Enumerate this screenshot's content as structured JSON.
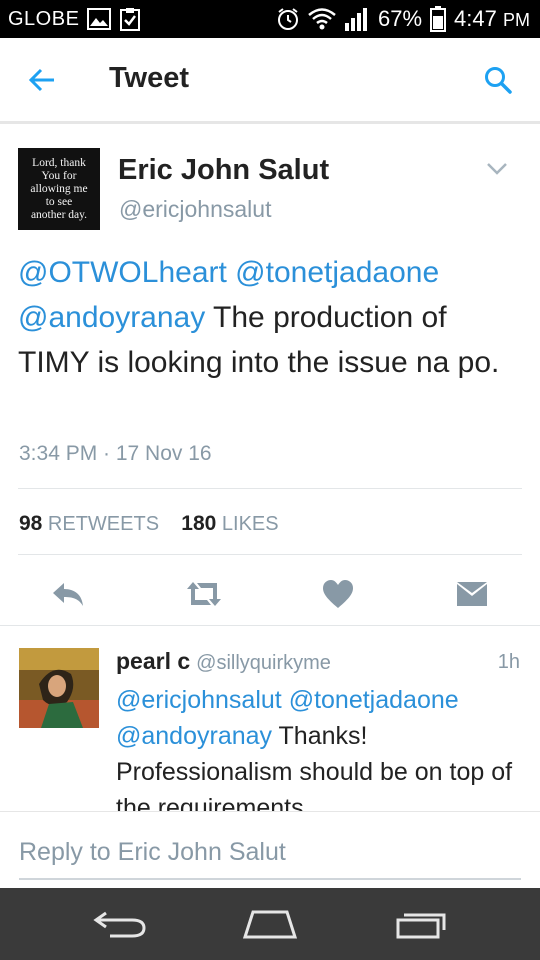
{
  "status_bar": {
    "carrier": "GLOBE",
    "battery": "67%",
    "time": "4:47",
    "time_suffix": "PM"
  },
  "app_bar": {
    "title": "Tweet",
    "back_icon": "back-arrow-icon",
    "search_icon": "search-icon"
  },
  "tweet": {
    "avatar_text_lines": [
      "Lord, thank",
      "You for",
      "allowing me",
      "to see",
      "another day."
    ],
    "author_name": "Eric John Salut",
    "author_handle": "@ericjohnsalut",
    "mentions": [
      "@OTWOLheart",
      "@tonetjadaone",
      "@andoyranay"
    ],
    "body": "The production of TIMY is looking into the issue na po.",
    "timestamp": "3:34 PM · 17 Nov 16",
    "retweet_count": "98",
    "retweet_label": "RETWEETS",
    "like_count": "180",
    "like_label": "LIKES",
    "actions": [
      "reply-icon",
      "retweet-icon",
      "heart-icon",
      "direct-message-icon"
    ]
  },
  "reply": {
    "name": "pearl c",
    "handle": "@sillyquirkyme",
    "time": "1h",
    "mentions": [
      "@ericjohnsalut",
      "@tonetjadaone",
      "@andoyranay"
    ],
    "body": "Thanks! Professionalism should be on top of the requirements"
  },
  "reply_input": {
    "placeholder": "Reply to Eric John Salut"
  },
  "colors": {
    "link": "#2b90d9",
    "muted": "#8899a6",
    "text": "#222222",
    "navbar": "#3a3a3a"
  }
}
